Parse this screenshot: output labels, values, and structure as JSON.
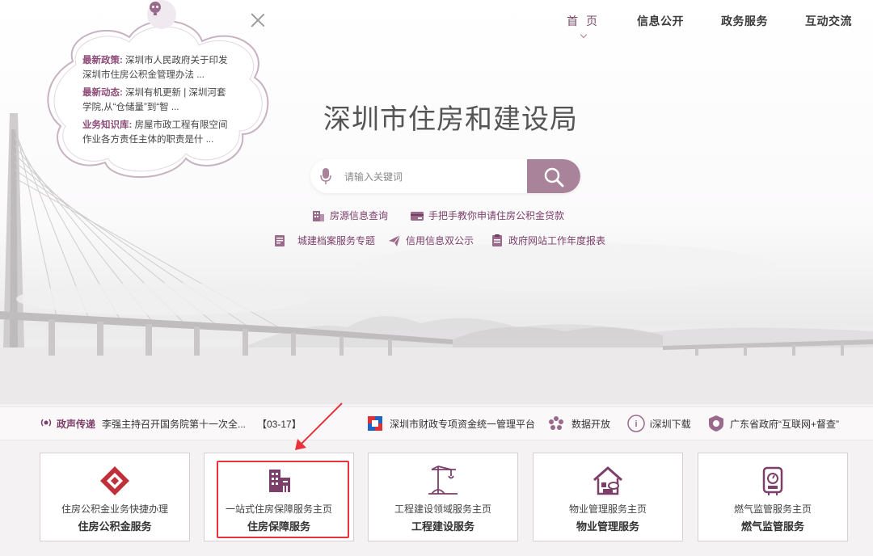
{
  "nav": {
    "items": [
      {
        "label": "首 页",
        "active": true
      },
      {
        "label": "信息公开"
      },
      {
        "label": "政务服务"
      },
      {
        "label": "互动交流"
      }
    ]
  },
  "bubble": {
    "news": [
      {
        "tag": "最新政策:",
        "text": "深圳市人民政府关于印发深圳市住房公积金管理办法 ..."
      },
      {
        "tag": "最新动态:",
        "text": "深圳有机更新 | 深圳河套学院,从“仓储量”到“智 ..."
      },
      {
        "tag": "业务知识库:",
        "text": "房屋市政工程有限空间作业各方责任主体的职责是什 ..."
      }
    ]
  },
  "site_title": "深圳市住房和建设局",
  "search": {
    "placeholder": "请输入关键词"
  },
  "quick_links": {
    "row1": [
      {
        "label": "房源信息查询",
        "icon": "building-chart-icon"
      },
      {
        "label": "手把手教你申请住房公积金贷款",
        "icon": "bank-card-icon"
      }
    ],
    "row2": [
      {
        "label": "城建档案服务专题",
        "icon": "archive-icon"
      },
      {
        "label": "信用信息双公示",
        "icon": "paper-plane-icon"
      },
      {
        "label": "政府网站工作年度报表",
        "icon": "report-icon"
      }
    ]
  },
  "ticker": {
    "label": "政声传递",
    "headline": "李强主持召开国务院第十一次全...",
    "date": "【03-17】",
    "links": [
      {
        "label": "深圳市财政专项资金统一管理平台",
        "icon": "finance-logo-icon"
      },
      {
        "label": "数据开放",
        "icon": "data-flower-icon"
      },
      {
        "label": "i深圳下载",
        "icon": "i-shenzhen-icon"
      },
      {
        "label": "广东省政府“互联网+督查”",
        "icon": "supervision-icon"
      }
    ]
  },
  "cards": [
    {
      "sub": "住房公积金业务快捷办理",
      "main": "住房公积金服务",
      "icon": "housing-fund-icon"
    },
    {
      "sub": "一站式住房保障服务主页",
      "main": "住房保障服务",
      "icon": "housing-security-icon"
    },
    {
      "sub": "工程建设领域服务主页",
      "main": "工程建设服务",
      "icon": "construction-crane-icon"
    },
    {
      "sub": "物业管理服务主页",
      "main": "物业管理服务",
      "icon": "property-house-icon"
    },
    {
      "sub": "燃气监管服务主页",
      "main": "燃气监管服务",
      "icon": "gas-meter-icon"
    }
  ],
  "colors": {
    "brand": "#7b3f6a",
    "accent": "#a98399",
    "highlight": "#e8333c"
  }
}
